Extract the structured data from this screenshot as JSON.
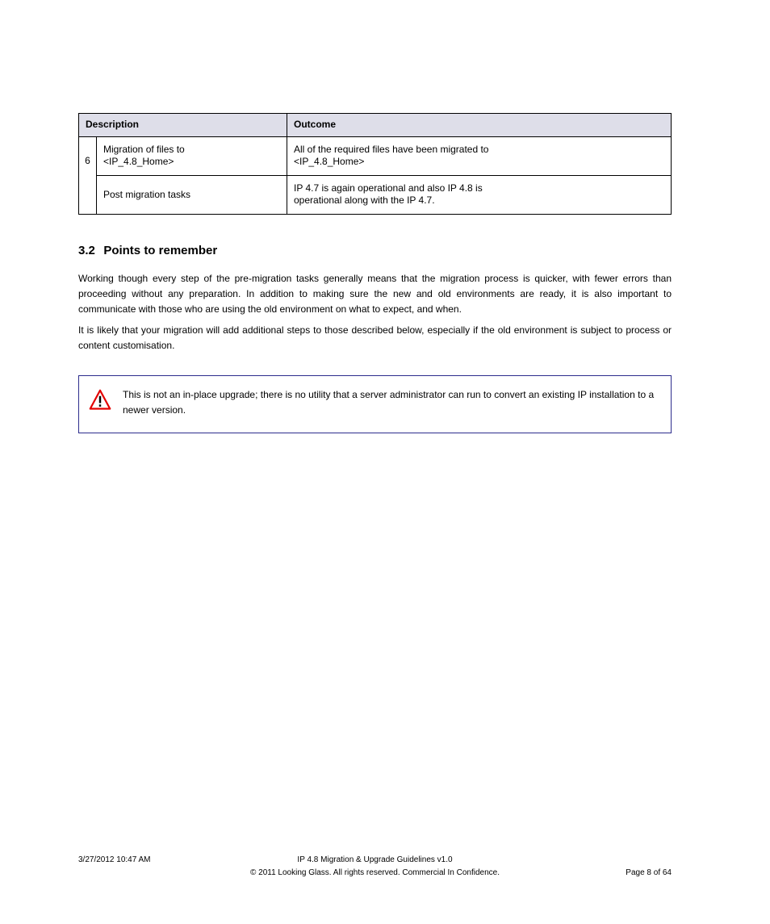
{
  "table": {
    "headers": {
      "description": "Description",
      "outcome": "Outcome"
    },
    "row_number": "6",
    "top_row": {
      "desc_line1": "Migration of files to",
      "desc_code": "<IP_4.8_Home>",
      "outcome_line1": "All of the required files have been migrated to",
      "outcome_code": "<IP_4.8_Home>"
    },
    "bottom_row": {
      "desc": "Post migration tasks",
      "outcome_line1": "IP 4.7 is again operational and also IP 4.8 is",
      "outcome_line2": "operational along with the IP 4.7."
    }
  },
  "section": {
    "number": "3.2",
    "title": "Points to remember"
  },
  "paragraphs": {
    "p1": "Working though every step of the pre-migration tasks generally means that the migration process is quicker, with fewer errors than proceeding without any preparation. In addition to making sure the new and old environments are ready, it is also important to communicate with those who are using the old environment on what to expect, and when.",
    "p2": "It is likely that your migration will add additional steps to those described below, especially if the old environment is subject to process or content customisation."
  },
  "alert": {
    "text": "This is not an in-place upgrade; there is no utility that a server administrator can run to convert an existing IP installation to a newer version."
  },
  "footer": {
    "timestamp": "3/27/2012 10:47 AM",
    "doc": "IP 4.8 Migration & Upgrade Guidelines v1.0",
    "copyright": "© 2011 Looking Glass. All rights reserved. Commercial In Confidence.",
    "page": "Page 8 of 64"
  }
}
